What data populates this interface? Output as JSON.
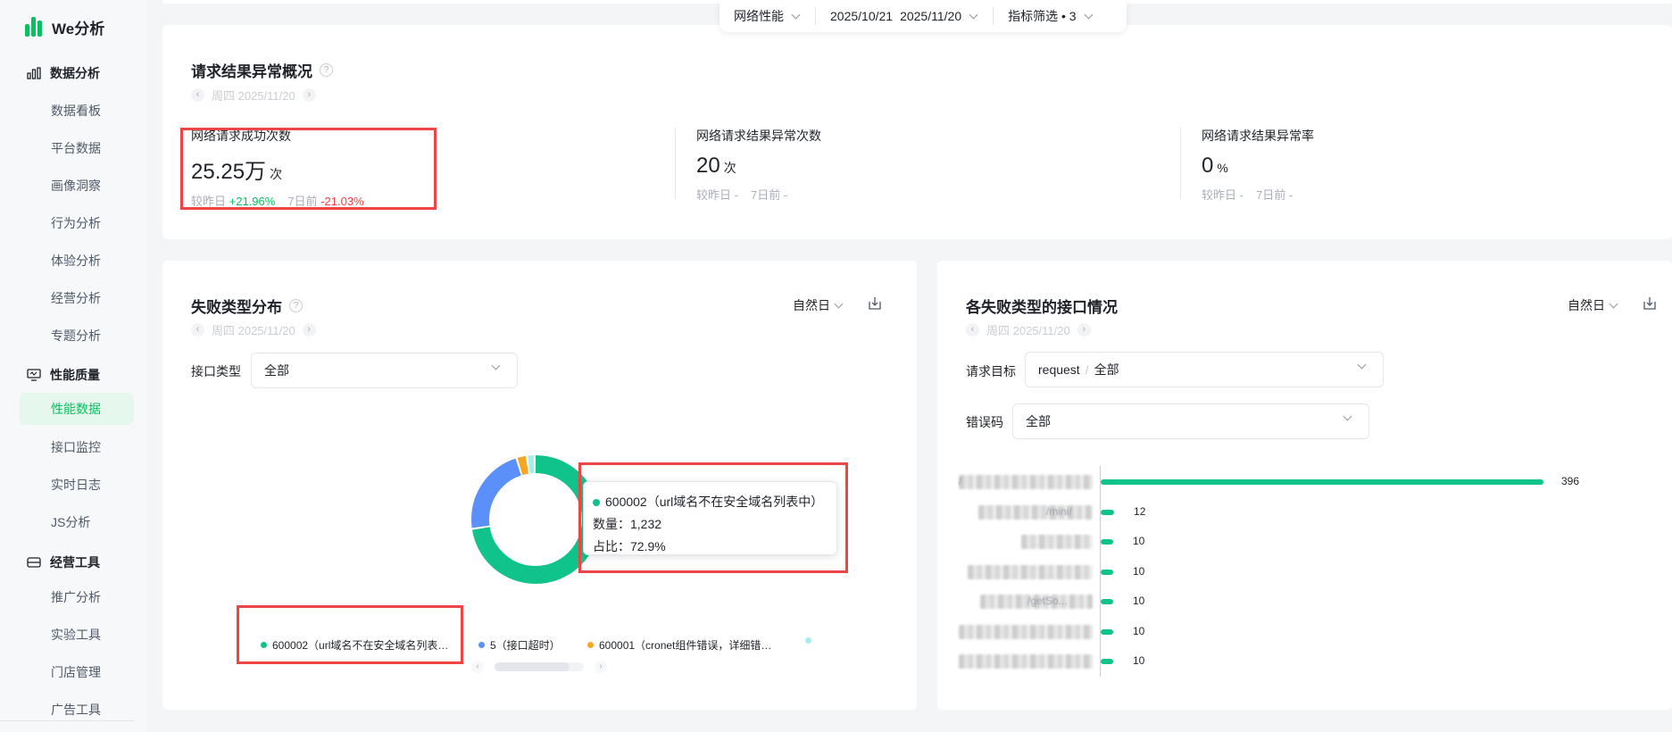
{
  "app": {
    "name": "We分析"
  },
  "sidebar": {
    "groups": [
      {
        "label": "数据分析",
        "icon": "bar-chart-icon",
        "items": [
          "数据看板",
          "平台数据",
          "画像洞察",
          "行为分析",
          "体验分析",
          "经营分析",
          "专题分析"
        ]
      },
      {
        "label": "性能质量",
        "icon": "monitor-icon",
        "items": [
          "性能数据",
          "接口监控",
          "实时日志",
          "JS分析"
        ]
      },
      {
        "label": "经营工具",
        "icon": "toolbox-icon",
        "items": [
          "推广分析",
          "实验工具",
          "门店管理",
          "广告工具"
        ]
      }
    ],
    "active_item": "性能数据"
  },
  "filterbar": {
    "category": "网络性能",
    "date_start": "2025/10/21",
    "date_end": "2025/11/20",
    "metric_filter": "指标筛选 • 3"
  },
  "overview": {
    "title": "请求结果异常概况",
    "date": "周四 2025/11/20",
    "metrics": [
      {
        "label": "网络请求成功次数",
        "value": "25.25万",
        "unit": "次",
        "cmp_day_label": "较昨日",
        "cmp_day": "+21.96%",
        "cmp_week_label": "7日前",
        "cmp_week": "-21.03%"
      },
      {
        "label": "网络请求结果异常次数",
        "value": "20",
        "unit": "次",
        "cmp_day_label": "较昨日",
        "cmp_day": "-",
        "cmp_week_label": "7日前",
        "cmp_week": "-"
      },
      {
        "label": "网络请求结果异常率",
        "value": "0",
        "unit": "%",
        "cmp_day_label": "较昨日",
        "cmp_day": "-",
        "cmp_week_label": "7日前",
        "cmp_week": "-"
      }
    ]
  },
  "distribution": {
    "title": "失败类型分布",
    "date": "周四 2025/11/20",
    "period": "自然日",
    "filter_label": "接口类型",
    "filter_value": "全部",
    "tooltip": {
      "name": "600002（url域名不在安全域名列表中）",
      "count_label": "数量：",
      "count": "1,232",
      "ratio_label": "占比：",
      "ratio": "72.9%"
    },
    "legend": [
      {
        "label": "600002（url域名不在安全域名列表…",
        "color": "#10c38a"
      },
      {
        "label": "5（接口超时）",
        "color": "#5b8ff9"
      },
      {
        "label": "600001（cronet组件错误，详细错…",
        "color": "#f5a623"
      },
      {
        "label": "",
        "color": "#a8ecf0"
      }
    ],
    "colors": {
      "primary": "#10c38a",
      "secondary": "#5b8ff9",
      "tertiary": "#f5a623",
      "quaternary": "#a8ecf0"
    }
  },
  "chart_data": {
    "type": "pie",
    "donut": true,
    "series": [
      {
        "name": "600002（url域名不在安全域名列表中）",
        "value": 1232,
        "share": 72.9
      },
      {
        "name": "5（接口超时）",
        "share": 22.5
      },
      {
        "name": "600001（cronet组件错误，详细错…",
        "share": 2.6
      },
      {
        "name": "",
        "share": 2.0
      }
    ]
  },
  "interfaces": {
    "title": "各失败类型的接口情况",
    "date": "周四 2025/11/20",
    "period": "自然日",
    "target_label": "请求目标",
    "target_value_a": "request",
    "target_value_b": "全部",
    "code_label": "错误码",
    "code_value": "全部",
    "bars": [
      {
        "label_hint": "/",
        "value": 396
      },
      {
        "label_hint": "/mini/",
        "value": 12
      },
      {
        "label_hint": "",
        "value": 10
      },
      {
        "label_hint": "",
        "value": 10
      },
      {
        "label_hint": "/getSo...",
        "value": 10
      },
      {
        "label_hint": "",
        "value": 10
      },
      {
        "label_hint": "",
        "value": 10
      }
    ],
    "bar_color": "#10c38a"
  }
}
